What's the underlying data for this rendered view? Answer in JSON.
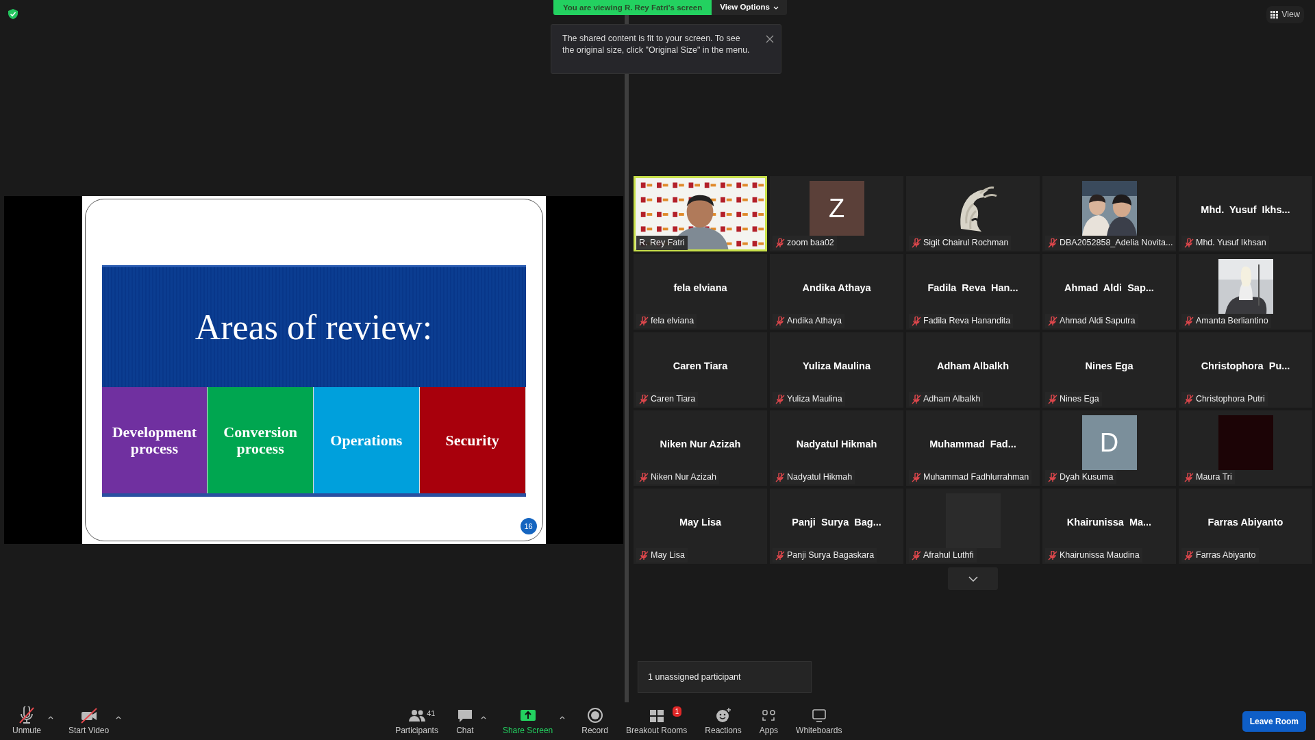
{
  "share_banner": {
    "text": "You are viewing R. Rey Fatri's screen",
    "menu": "View Options"
  },
  "share_tip": {
    "text": "The shared content is fit to your screen. To see the original size, click \"Original Size\" in the menu."
  },
  "view_button": {
    "label": "View"
  },
  "slide": {
    "title": "Areas of review:",
    "page_number": "16",
    "boxes": [
      {
        "label": "Development process",
        "color": "#7030a0"
      },
      {
        "label": "Conversion process",
        "color": "#00a650"
      },
      {
        "label": "Operations",
        "color": "#00a0dc"
      },
      {
        "label": "Security",
        "color": "#a8000c"
      }
    ]
  },
  "gallery": [
    {
      "kind": "video",
      "label": "R. Rey Fatri",
      "muted": false,
      "active_speaker": true
    },
    {
      "kind": "avatar",
      "letter": "Z",
      "color": "#5b4039",
      "label": "zoom baa02",
      "muted": true,
      "active_speaker": false
    },
    {
      "kind": "knight",
      "label": "Sigit Chairul Rochman",
      "muted": true,
      "active_speaker": false
    },
    {
      "label": "DBA2052858_Adelia Novita...",
      "muted": true,
      "active_speaker": false
    },
    {
      "kind": "name",
      "name": "Mhd.  Yusuf  Ikhs...",
      "label": "Mhd. Yusuf Ikhsan",
      "muted": true,
      "active_speaker": false
    },
    {
      "kind": "name",
      "name": "fela elviana",
      "label": "fela elviana",
      "muted": true,
      "active_speaker": false
    },
    {
      "kind": "name",
      "name": "Andika Athaya",
      "label": "Andika Athaya",
      "muted": true,
      "active_speaker": false
    },
    {
      "kind": "name",
      "name": "Fadila  Reva  Han...",
      "label": "Fadila Reva Hanandita",
      "muted": true,
      "active_speaker": false
    },
    {
      "kind": "name",
      "name": "Ahmad  Aldi  Sap...",
      "label": "Ahmad Aldi Saputra",
      "muted": true,
      "active_speaker": false
    },
    {
      "kind": "rider",
      "label": "Amanta Berliantino",
      "muted": true,
      "active_speaker": false
    },
    {
      "kind": "name",
      "name": "Caren Tiara",
      "label": "Caren Tiara",
      "muted": true,
      "active_speaker": false
    },
    {
      "kind": "name",
      "name": "Yuliza Maulina",
      "label": "Yuliza Maulina",
      "muted": true,
      "active_speaker": false
    },
    {
      "kind": "name",
      "name": "Adham Albalkh",
      "label": "Adham Albalkh",
      "muted": true,
      "active_speaker": false
    },
    {
      "kind": "name",
      "name": "Nines Ega",
      "label": "Nines Ega",
      "muted": true,
      "active_speaker": false
    },
    {
      "kind": "name",
      "name": "Christophora  Pu...",
      "label": "Christophora Putri",
      "muted": true,
      "active_speaker": false
    },
    {
      "kind": "name",
      "name": "Niken Nur Azizah",
      "label": "Niken Nur Azizah",
      "muted": true,
      "active_speaker": false
    },
    {
      "kind": "name",
      "name": "Nadyatul Hikmah",
      "label": "Nadyatul Hikmah",
      "muted": true,
      "active_speaker": false
    },
    {
      "kind": "name",
      "name": "Muhammad  Fad...",
      "label": "Muhammad Fadhlurrahman",
      "muted": true,
      "active_speaker": false
    },
    {
      "kind": "avatar",
      "letter": "D",
      "color": "#7b8f9b",
      "label": "Dyah Kusuma",
      "muted": true,
      "active_speaker": false
    },
    {
      "kind": "dark",
      "color": "#1c0406",
      "label": "Maura Tri",
      "muted": true,
      "active_speaker": false
    },
    {
      "kind": "name",
      "name": "May Lisa",
      "label": "May Lisa",
      "muted": true,
      "active_speaker": false
    },
    {
      "kind": "name",
      "name": "Panji  Surya  Bag...",
      "label": "Panji Surya Bagaskara",
      "muted": true,
      "active_speaker": false
    },
    {
      "kind": "dark",
      "color": "#2b2b2b",
      "label": "Afrahul Luthfi",
      "muted": true,
      "active_speaker": false
    },
    {
      "kind": "name",
      "name": "Khairunissa  Ma...",
      "label": "Khairunissa Maudina",
      "muted": true,
      "active_speaker": false
    },
    {
      "kind": "name",
      "name": "Farras Abiyanto",
      "label": "Farras Abiyanto",
      "muted": true,
      "active_speaker": false
    }
  ],
  "breakout_tip": {
    "text": "1 unassigned participant"
  },
  "toolbar": {
    "left": [
      {
        "kind": "mic_off",
        "label": "Unmute",
        "caret": true
      },
      {
        "kind": "video_off",
        "label": "Start Video",
        "caret": true
      }
    ],
    "center": [
      {
        "kind": "participants",
        "label": "Participants",
        "count": "41",
        "caret": false
      },
      {
        "kind": "chat",
        "label": "Chat",
        "caret": true
      },
      {
        "kind": "share",
        "label": "Share Screen",
        "caret": true
      },
      {
        "kind": "record",
        "label": "Record",
        "caret": false
      },
      {
        "kind": "breakout",
        "label": "Breakout Rooms",
        "badge": "1",
        "caret": false
      },
      {
        "kind": "reactions",
        "label": "Reactions",
        "caret": false
      },
      {
        "kind": "apps",
        "label": "Apps",
        "caret": false
      },
      {
        "kind": "whiteboards",
        "label": "Whiteboards",
        "caret": false
      }
    ],
    "leave": "Leave Room"
  }
}
